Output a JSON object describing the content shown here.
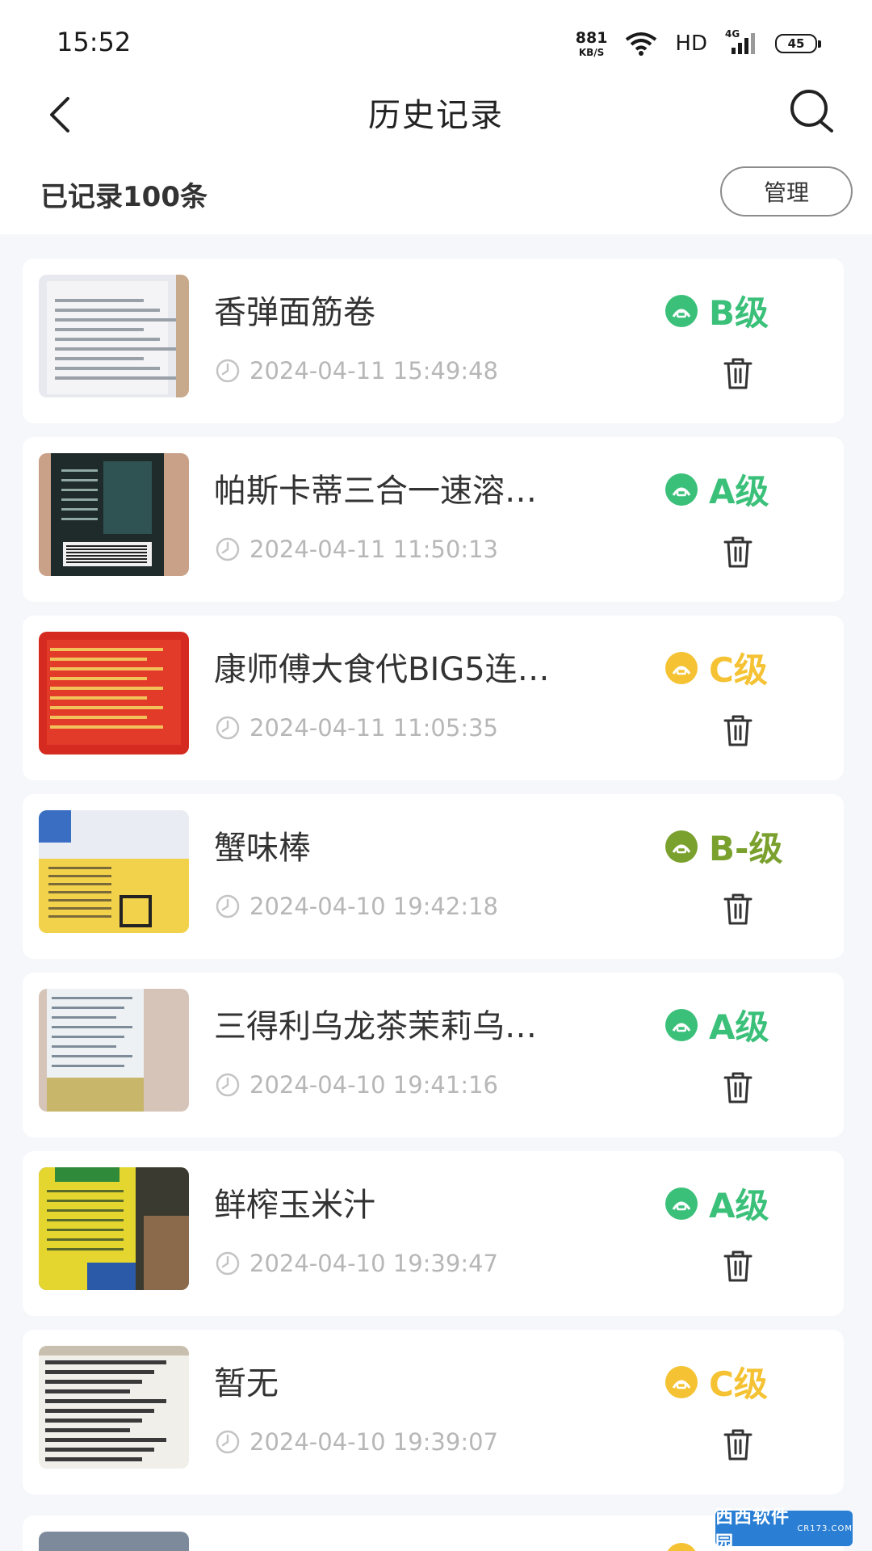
{
  "status_bar": {
    "time": "15:52",
    "net_speed_value": "881",
    "net_speed_unit": "KB/S",
    "hd_label": "HD",
    "network_label": "4G",
    "battery_level": "45"
  },
  "nav": {
    "title": "历史记录",
    "back_icon": "chevron-left-icon",
    "search_icon": "search-icon"
  },
  "summary": {
    "count_text": "已记录100条",
    "manage_label": "管理"
  },
  "colors": {
    "grade_green": "#3bc07a",
    "grade_yellow": "#f5c233",
    "grade_olive": "#7aa02d",
    "time_gray": "#b7b7b7",
    "page_bg": "#f5f7fb"
  },
  "items": [
    {
      "name": "香弹面筋卷",
      "time": "2024-04-11 15:49:48",
      "grade": "B级",
      "grade_color": "#3bc07a",
      "thumb": "white-bag"
    },
    {
      "name": "帕斯卡蒂三合一速溶…",
      "time": "2024-04-11 11:50:13",
      "grade": "A级",
      "grade_color": "#3bc07a",
      "thumb": "dark-jar"
    },
    {
      "name": "康师傅大食代BIG5连…",
      "time": "2024-04-11 11:05:35",
      "grade": "C级",
      "grade_color": "#f5c233",
      "thumb": "red-pack"
    },
    {
      "name": "蟹味棒",
      "time": "2024-04-10 19:42:18",
      "grade": "B-级",
      "grade_color": "#7aa02d",
      "thumb": "yellow-pack"
    },
    {
      "name": "三得利乌龙茶茉莉乌…",
      "time": "2024-04-10 19:41:16",
      "grade": "A级",
      "grade_color": "#3bc07a",
      "thumb": "bottle"
    },
    {
      "name": "鲜榨玉米汁",
      "time": "2024-04-10 19:39:47",
      "grade": "A级",
      "grade_color": "#3bc07a",
      "thumb": "yellow-bottle"
    },
    {
      "name": "暂无",
      "time": "2024-04-10 19:39:07",
      "grade": "C级",
      "grade_color": "#f5c233",
      "thumb": "label"
    }
  ],
  "partial_item": {
    "grade_color": "#f5c233"
  },
  "watermark": {
    "text": "西西软件园",
    "sub": "CR173.COM"
  }
}
